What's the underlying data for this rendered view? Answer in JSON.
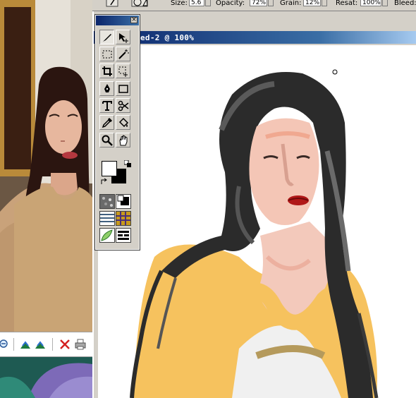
{
  "options_bar": {
    "size_label": "Size:",
    "size_value": "5.6",
    "opacity_label": "Opacity:",
    "opacity_value": "72%",
    "grain_label": "Grain:",
    "grain_value": "12%",
    "resat_label": "Resat:",
    "resat_value": "100%",
    "bleed_label": "Bleed:"
  },
  "document": {
    "title": "ed-2 @ 100%"
  },
  "tool_palette": {
    "close_symbol": "×",
    "tools": [
      "brush",
      "move",
      "rect-select",
      "magic-wand",
      "crop",
      "lasso",
      "pen",
      "shape",
      "text",
      "scissors",
      "eyedropper",
      "paint-bucket",
      "magnifier",
      "grabber"
    ],
    "active_tool": "brush"
  },
  "colors": {
    "titlebar": "#0a246a",
    "canvas": "#ffffff",
    "hair": "#2a2a2a",
    "sweater": "#f6c25e",
    "skin": "#f4c6b6",
    "lips": "#b01818"
  }
}
